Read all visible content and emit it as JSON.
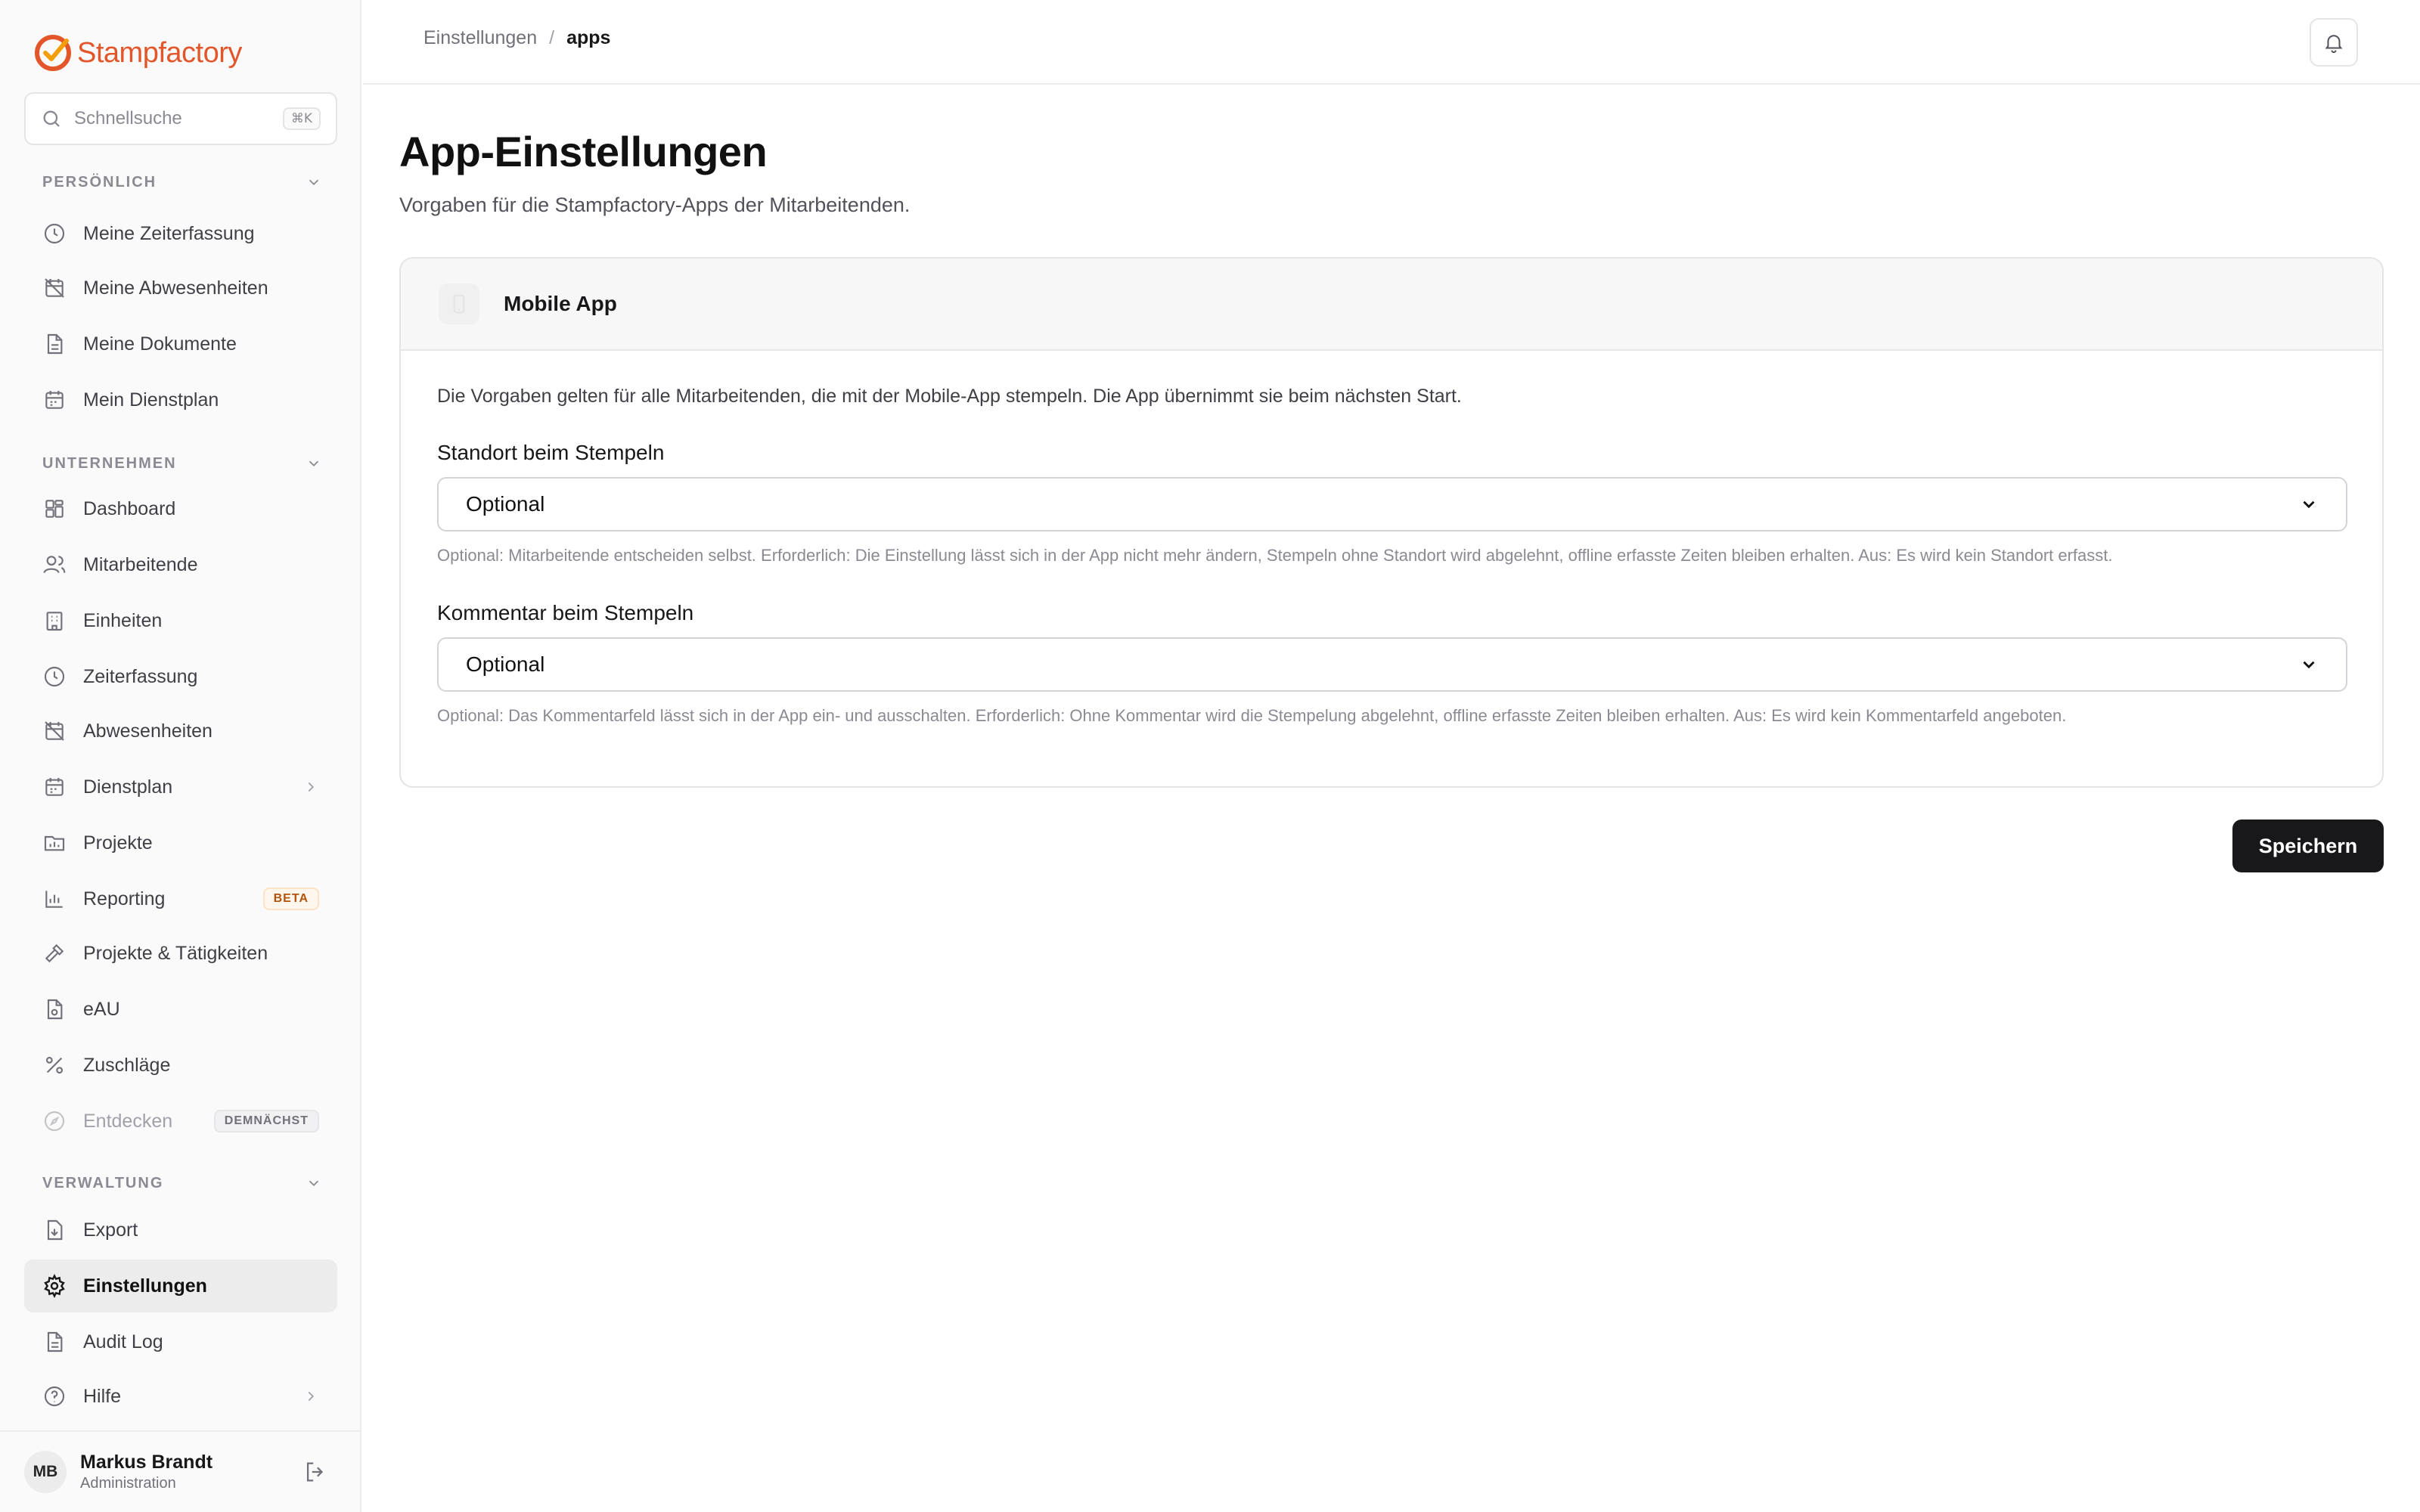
{
  "brand": {
    "name_part1": "Stamp",
    "name_part2": "factory"
  },
  "search": {
    "placeholder": "Schnellsuche",
    "shortcut": "⌘K"
  },
  "sections": {
    "personal": "PERSÖNLICH",
    "company": "UNTERNEHMEN",
    "admin": "VERWALTUNG"
  },
  "nav": {
    "personal": [
      {
        "label": "Meine Zeiterfassung",
        "icon": "clock-icon"
      },
      {
        "label": "Meine Abwesenheiten",
        "icon": "calendar-off-icon"
      },
      {
        "label": "Meine Dokumente",
        "icon": "document-icon"
      },
      {
        "label": "Mein Dienstplan",
        "icon": "calendar-icon"
      }
    ],
    "company": [
      {
        "label": "Dashboard",
        "icon": "dashboard-icon"
      },
      {
        "label": "Mitarbeitende",
        "icon": "users-icon"
      },
      {
        "label": "Einheiten",
        "icon": "building-icon"
      },
      {
        "label": "Zeiterfassung",
        "icon": "clock-icon"
      },
      {
        "label": "Abwesenheiten",
        "icon": "calendar-off-icon"
      },
      {
        "label": "Dienstplan",
        "icon": "calendar-icon"
      },
      {
        "label": "Projekte",
        "icon": "folder-chart-icon"
      },
      {
        "label": "Reporting",
        "icon": "bar-chart-icon",
        "badge": "BETA"
      },
      {
        "label": "Projekte & Tätigkeiten",
        "icon": "hammer-icon"
      },
      {
        "label": "eAU",
        "icon": "file-medical-icon"
      },
      {
        "label": "Zuschläge",
        "icon": "percent-icon"
      },
      {
        "label": "Entdecken",
        "icon": "compass-icon",
        "badge": "DEMNÄCHST"
      }
    ],
    "admin": [
      {
        "label": "Export",
        "icon": "download-file-icon"
      },
      {
        "label": "Einstellungen",
        "icon": "gear-icon"
      },
      {
        "label": "Audit Log",
        "icon": "document-icon"
      },
      {
        "label": "Hilfe",
        "icon": "help-circle-icon"
      }
    ]
  },
  "user": {
    "initials": "MB",
    "name": "Markus Brandt",
    "role": "Administration"
  },
  "breadcrumb": {
    "parent": "Einstellungen",
    "separator": "/",
    "current": "apps"
  },
  "page": {
    "title": "App-Einstellungen",
    "subtitle": "Vorgaben für die Stampfactory-Apps der Mitarbeitenden."
  },
  "card": {
    "title": "Mobile App",
    "intro": "Die Vorgaben gelten für alle Mitarbeitenden, die mit der Mobile-App stempeln. Die App übernimmt sie beim nächsten Start.",
    "fields": [
      {
        "label": "Standort beim Stempeln",
        "value": "Optional",
        "help": "Optional: Mitarbeitende entscheiden selbst. Erforderlich: Die Einstellung lässt sich in der App nicht mehr ändern, Stempeln ohne Standort wird abgelehnt, offline erfasste Zeiten bleiben erhalten. Aus: Es wird kein Standort erfasst."
      },
      {
        "label": "Kommentar beim Stempeln",
        "value": "Optional",
        "help": "Optional: Das Kommentarfeld lässt sich in der App ein- und ausschalten. Erforderlich: Ohne Kommentar wird die Stempelung abgelehnt, offline erfasste Zeiten bleiben erhalten. Aus: Es wird kein Kommentarfeld angeboten."
      }
    ]
  },
  "actions": {
    "save": "Speichern"
  },
  "colors": {
    "brand_orange": "#e2562a",
    "active_bg": "#ececec",
    "primary_button": "#18181b"
  }
}
